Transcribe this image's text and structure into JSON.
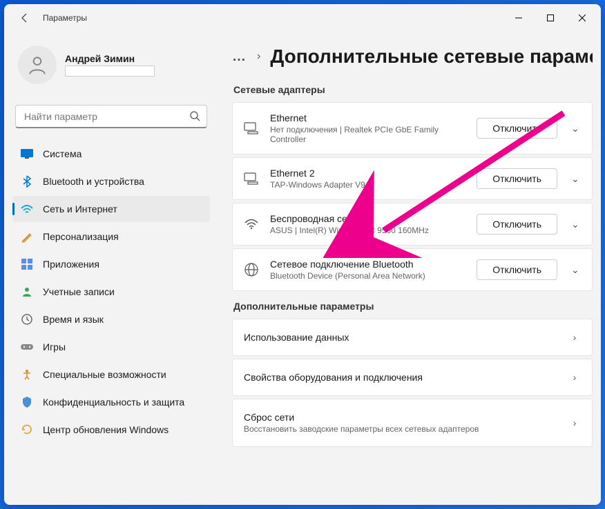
{
  "window": {
    "title": "Параметры"
  },
  "profile": {
    "name": "Андрей Зимин"
  },
  "search": {
    "placeholder": "Найти параметр"
  },
  "nav": {
    "items": [
      {
        "label": "Система",
        "icon": "system"
      },
      {
        "label": "Bluetooth и устройства",
        "icon": "bluetooth"
      },
      {
        "label": "Сеть и Интернет",
        "icon": "network",
        "selected": true
      },
      {
        "label": "Персонализация",
        "icon": "personalize"
      },
      {
        "label": "Приложения",
        "icon": "apps"
      },
      {
        "label": "Учетные записи",
        "icon": "accounts"
      },
      {
        "label": "Время и язык",
        "icon": "time"
      },
      {
        "label": "Игры",
        "icon": "gaming"
      },
      {
        "label": "Специальные возможности",
        "icon": "accessibility"
      },
      {
        "label": "Конфиденциальность и защита",
        "icon": "privacy"
      },
      {
        "label": "Центр обновления Windows",
        "icon": "update"
      }
    ]
  },
  "breadcrumb": {
    "dots": "…",
    "title": "Дополнительные сетевые параметры"
  },
  "sections": {
    "adapters_header": "Сетевые адаптеры",
    "additional_header": "Дополнительные параметры"
  },
  "adapters": [
    {
      "title": "Ethernet",
      "sub": "Нет подключения | Realtek PCIe GbE Family Controller",
      "button": "Отключить"
    },
    {
      "title": "Ethernet 2",
      "sub": "TAP-Windows Adapter V9",
      "button": "Отключить"
    },
    {
      "title": "Беспроводная сеть",
      "sub": "ASUS | Intel(R) Wireless-AC 9560 160MHz",
      "button": "Отключить"
    },
    {
      "title": "Сетевое подключение Bluetooth",
      "sub": "Bluetooth Device (Personal Area Network)",
      "button": "Отключить"
    }
  ],
  "links": [
    {
      "title": "Использование данных",
      "sub": ""
    },
    {
      "title": "Свойства оборудования и подключения",
      "sub": ""
    },
    {
      "title": "Сброс сети",
      "sub": "Восстановить заводские параметры всех сетевых адаптеров"
    }
  ]
}
